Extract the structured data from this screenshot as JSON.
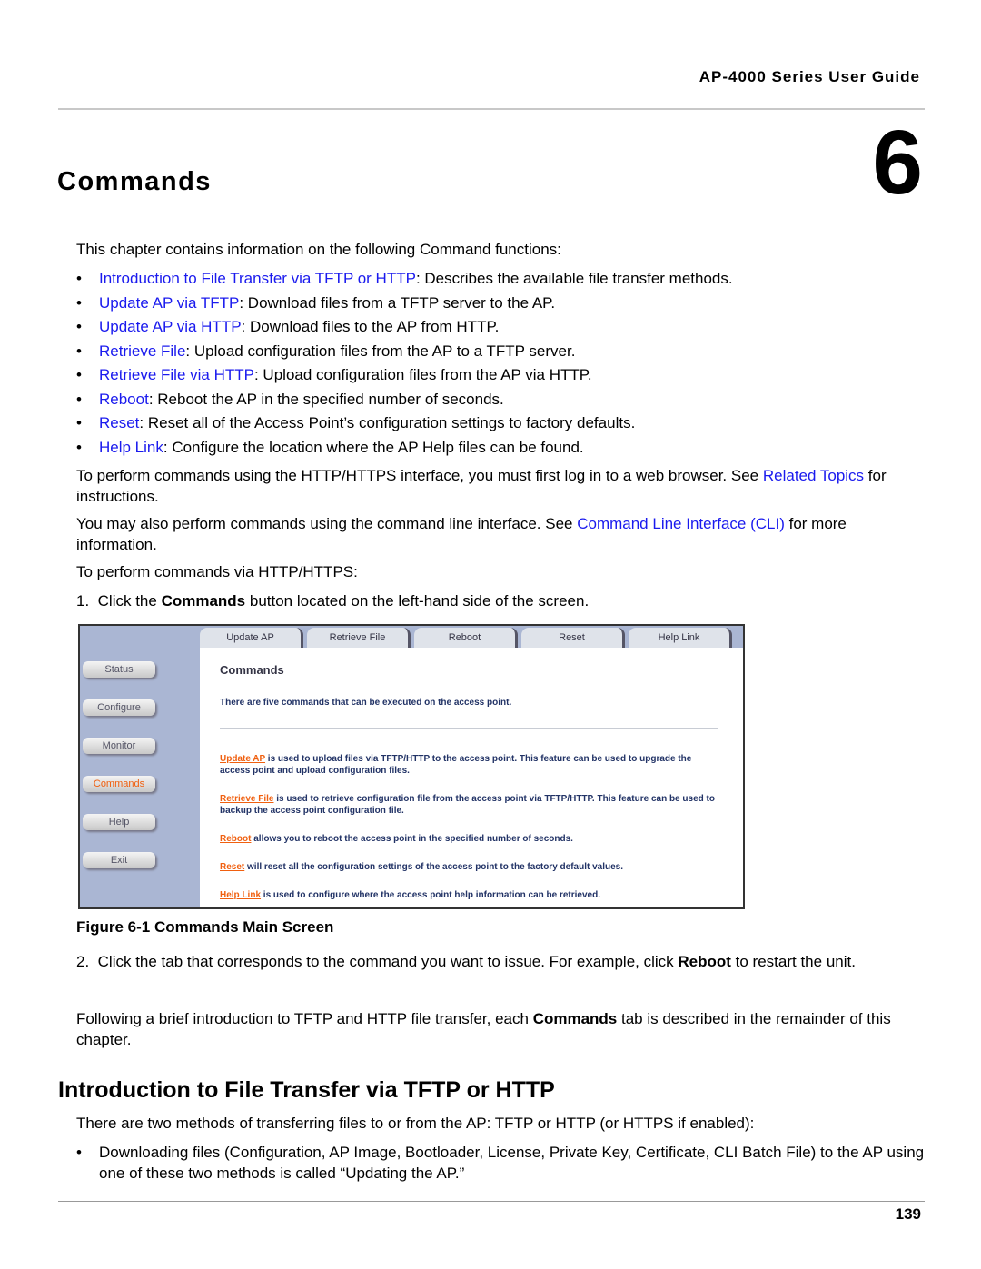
{
  "header": {
    "guide_title": "AP-4000 Series User Guide",
    "chapter_number": "6",
    "chapter_title": "Commands"
  },
  "intro": "This chapter contains information on the following Command functions:",
  "bullets": [
    {
      "link": "Introduction to File Transfer via TFTP or HTTP",
      "text": ": Describes the available file transfer methods."
    },
    {
      "link": "Update AP via TFTP",
      "text": ": Download files from a TFTP server to the AP."
    },
    {
      "link": "Update AP via HTTP",
      "text": ": Download files to the AP from HTTP."
    },
    {
      "link": "Retrieve File",
      "text": ": Upload configuration files from the AP to a TFTP server."
    },
    {
      "link": "Retrieve File via HTTP",
      "text": ": Upload configuration files from the AP via HTTP."
    },
    {
      "link": "Reboot",
      "text": ": Reboot the AP in the specified number of seconds."
    },
    {
      "link": "Reset",
      "text": ": Reset all of the Access Point’s configuration settings to factory defaults."
    },
    {
      "link": "Help Link",
      "text": ": Configure the location where the AP Help files can be found."
    }
  ],
  "para1": {
    "pre": "To perform commands using the HTTP/HTTPS interface, you must first log in to a web browser. See ",
    "link": "Related Topics",
    "post": " for instructions."
  },
  "para2": {
    "pre": "You may also perform commands using the command line interface. See ",
    "link": "Command Line Interface (CLI)",
    "post": " for more information."
  },
  "para3": "To perform commands via HTTP/HTTPS:",
  "step1": {
    "num": "1.",
    "pre": "Click the ",
    "bold": "Commands",
    "post": " button located on the left-hand side of the screen."
  },
  "figure": {
    "tabs": [
      "Update AP",
      "Retrieve File",
      "Reboot",
      "Reset",
      "Help Link"
    ],
    "side_buttons": [
      "Status",
      "Configure",
      "Monitor",
      "Commands",
      "Help",
      "Exit"
    ],
    "active_button": "Commands",
    "heading": "Commands",
    "lead": "There are five commands that can be executed on the access point.",
    "items": [
      {
        "link": "Update AP",
        "text": " is used to upload files via TFTP/HTTP to the access point. This feature can be used to upgrade the access point and upload configuration files."
      },
      {
        "link": "Retrieve File",
        "text": " is used to retrieve configuration file from the access point via TFTP/HTTP. This feature can be used to backup the access point configuration file."
      },
      {
        "link": "Reboot",
        "text": " allows you to reboot the access point in the specified number of seconds."
      },
      {
        "link": "Reset",
        "text": " will reset all the configuration settings of the access point to the factory default values."
      },
      {
        "link": "Help Link",
        "text": " is used to configure where the access point help information can be retrieved."
      }
    ],
    "caption": "Figure 6-1 Commands Main Screen"
  },
  "step2": {
    "num": "2.",
    "pre": "Click the tab that corresponds to the command you want to issue. For example, click ",
    "bold": "Reboot",
    "post": " to restart the unit."
  },
  "para4": {
    "pre": "Following a brief introduction to TFTP and HTTP file transfer, each ",
    "bold": "Commands",
    "post": " tab is described in the remainder of this chapter."
  },
  "section_title": "Introduction to File Transfer via TFTP or HTTP",
  "para5": "There are two methods of transferring files to or from the AP: TFTP or HTTP (or HTTPS if enabled):",
  "bullet2": "Downloading files (Configuration, AP Image, Bootloader, License, Private Key, Certificate, CLI Batch File) to the AP using one of these two methods is called “Updating the AP.”",
  "footer": {
    "page_number": "139"
  },
  "colors": {
    "link": "#1a1aee",
    "figure_link": "#f06010",
    "figure_sidebar": "#aab6d3"
  }
}
